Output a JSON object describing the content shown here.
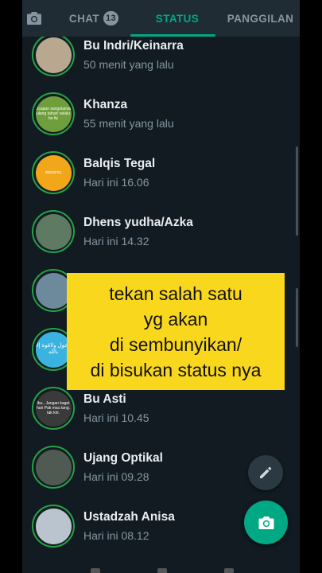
{
  "tabs": {
    "chat": {
      "label": "CHAT",
      "badge": "13"
    },
    "status": {
      "label": "STATUS"
    },
    "calls": {
      "label": "PANGGILAN"
    }
  },
  "colors": {
    "accent": "#00a884",
    "ring": "#25a244",
    "background": "#121b22",
    "overlay": "#f9d71c"
  },
  "contacts": [
    {
      "name": "Bu Indri/Keinarra",
      "time": "50 menit yang lalu",
      "avatar_color": "#b7a88f"
    },
    {
      "name": "Khanza",
      "time": "55 menit yang lalu",
      "avatar_color": "#6f9f3c",
      "avatar_text": "Ucapan sangelamat ulang tahun! selalu be tly"
    },
    {
      "name": "Balqis Tegal",
      "time": "Hari ini 16.06",
      "avatar_color": "#f2a71b",
      "avatar_text": "statusmu"
    },
    {
      "name": "Dhens yudha/Azka",
      "time": "Hari ini 14.32",
      "avatar_color": "#5f7a63"
    },
    {
      "name": "",
      "time": "",
      "avatar_color": "#6d8a9c"
    },
    {
      "name": "",
      "time": "",
      "avatar_color": "#3ab3e0",
      "avatar_text": "لاحول ولاقوة إلا بالله"
    },
    {
      "name": "Bu Asti",
      "time": "Hari ini 10.45",
      "avatar_color": "#3a3a3a",
      "avatar_text": "Ibu.. Jangan kaget hari Pak mau tang. tak kiri."
    },
    {
      "name": "Ujang Optikal",
      "time": "Hari ini 09.28",
      "avatar_color": "#4f5a52"
    },
    {
      "name": "Ustadzah Anisa",
      "time": "Hari ini 08.12",
      "avatar_color": "#b9c4cf"
    }
  ],
  "overlay": {
    "lines": [
      "tekan salah satu",
      "yg akan",
      "di sembunyikan/",
      "di bisukan status nya"
    ]
  },
  "icons": {
    "camera_tab": "camera-icon",
    "edit_fab": "pencil-icon",
    "camera_fab": "camera-icon"
  }
}
